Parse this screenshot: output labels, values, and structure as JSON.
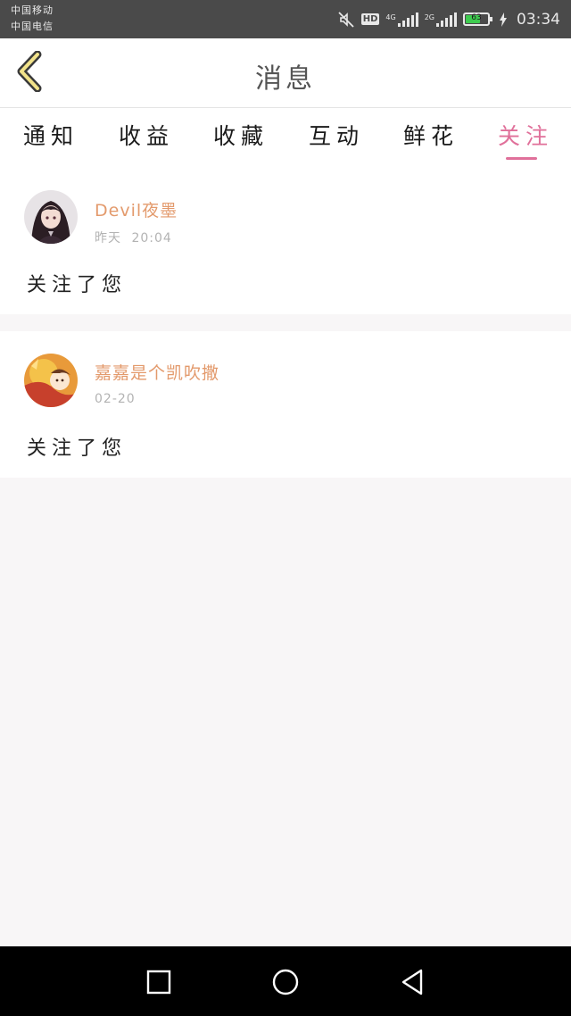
{
  "status_bar": {
    "carrier_1": "中国移动",
    "carrier_2": "中国电信",
    "hd_label": "HD",
    "net_1_label": "4G",
    "net_2_label": "2G",
    "battery_level": "63",
    "time": "03:34",
    "icons": [
      "mute-icon",
      "signal-icon",
      "battery-icon",
      "charging-icon"
    ]
  },
  "header": {
    "title": "消息",
    "back_icon": "chevron-left-icon"
  },
  "tabs": [
    {
      "label": "通知",
      "active": false
    },
    {
      "label": "收益",
      "active": false
    },
    {
      "label": "收藏",
      "active": false
    },
    {
      "label": "互动",
      "active": false
    },
    {
      "label": "鲜花",
      "active": false
    },
    {
      "label": "关注",
      "active": true
    }
  ],
  "messages": [
    {
      "user": "Devil夜墨",
      "time_day": "昨天",
      "time_clock": "20:04",
      "text": "关注了您"
    },
    {
      "user": "嘉嘉是个凯吹撒",
      "time_day": "02-20",
      "text": "关注了您"
    }
  ],
  "colors": {
    "accent": "#e0709a",
    "username": "#e39a6c",
    "background": "#f8f6f7"
  },
  "nav_bar": {
    "icons": [
      "recent-apps-icon",
      "home-icon",
      "back-icon"
    ]
  }
}
